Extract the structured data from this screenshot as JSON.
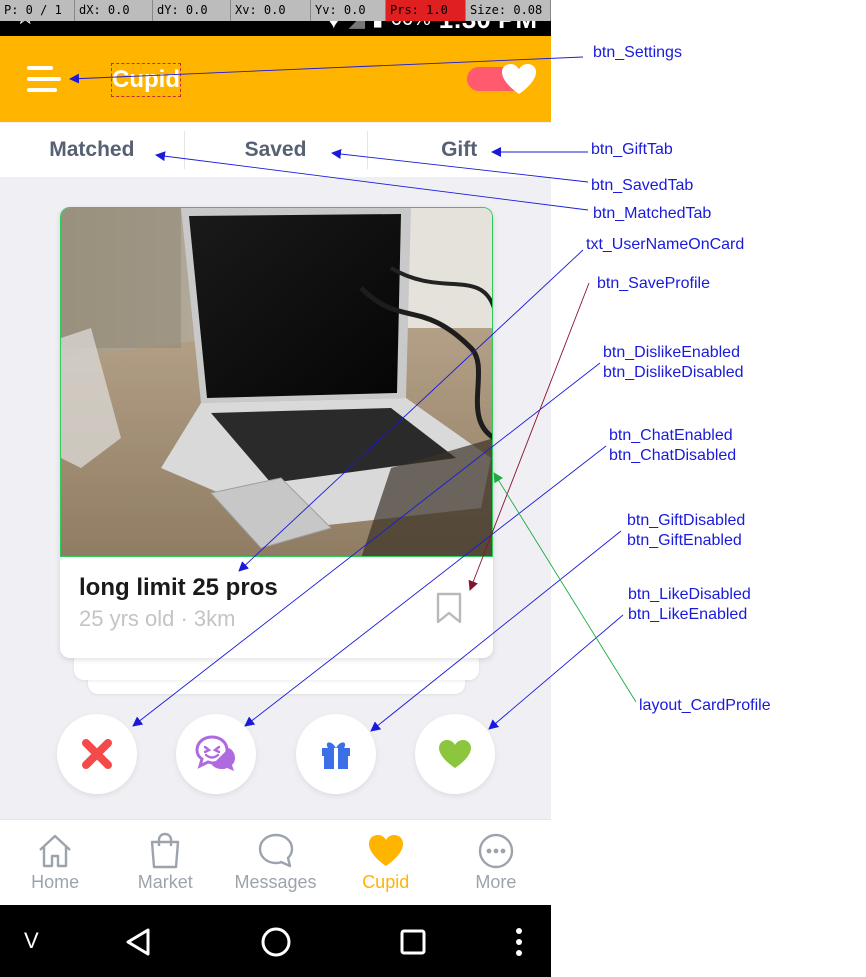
{
  "debug_bar": {
    "p": "P: 0 / 1",
    "dx": "dX: 0.0",
    "dy": "dY: 0.0",
    "xv": "Xv: 0.0",
    "yv": "Yv: 0.0",
    "prs": "Prs: 1.0",
    "size": "Size: 0.08"
  },
  "status_bar": {
    "battery": "66%",
    "time": "1:30 PM"
  },
  "header": {
    "title": "Cupid",
    "bg_color": "#ffb400",
    "toggle_color": "#ff5a6e"
  },
  "tabs": [
    {
      "label": "Matched"
    },
    {
      "label": "Saved"
    },
    {
      "label": "Gift"
    }
  ],
  "card": {
    "name": "long limit 25 pros",
    "subtitle": "25 yrs old · 3km"
  },
  "actions": [
    {
      "name": "dislike-button",
      "icon": "x-icon",
      "color": "#f44a4a"
    },
    {
      "name": "chat-button",
      "icon": "chat-bubbles-icon",
      "color": "#b06ae0"
    },
    {
      "name": "gift-button",
      "icon": "gift-icon",
      "color": "#3b6fe8"
    },
    {
      "name": "like-button",
      "icon": "heart-icon",
      "color": "#8cc63f"
    }
  ],
  "bottom_nav": [
    {
      "label": "Home",
      "icon": "home-icon"
    },
    {
      "label": "Market",
      "icon": "shopping-bag-icon"
    },
    {
      "label": "Messages",
      "icon": "chat-icon"
    },
    {
      "label": "Cupid",
      "icon": "heart-icon",
      "active": true
    },
    {
      "label": "More",
      "icon": "more-icon"
    }
  ],
  "system_nav": {
    "chevron": "V"
  },
  "annotations": {
    "settings": "btn_Settings",
    "gift_tab": "btn_GiftTab",
    "saved_tab": "btn_SavedTab",
    "matched_tab": "btn_MatchedTab",
    "username": "txt_UserNameOnCard",
    "save_profile": "btn_SaveProfile",
    "dislike_enabled": "btn_DislikeEnabled",
    "dislike_disabled": "btn_DislikeDisabled",
    "chat_enabled": "btn_ChatEnabled",
    "chat_disabled": "btn_ChatDisabled",
    "gift_disabled": "btn_GiftDisabled",
    "gift_enabled": "btn_GiftEnabled",
    "like_disabled": "btn_LikeDisabled",
    "like_enabled": "btn_LikeEnabled",
    "card_profile": "layout_CardProfile"
  }
}
